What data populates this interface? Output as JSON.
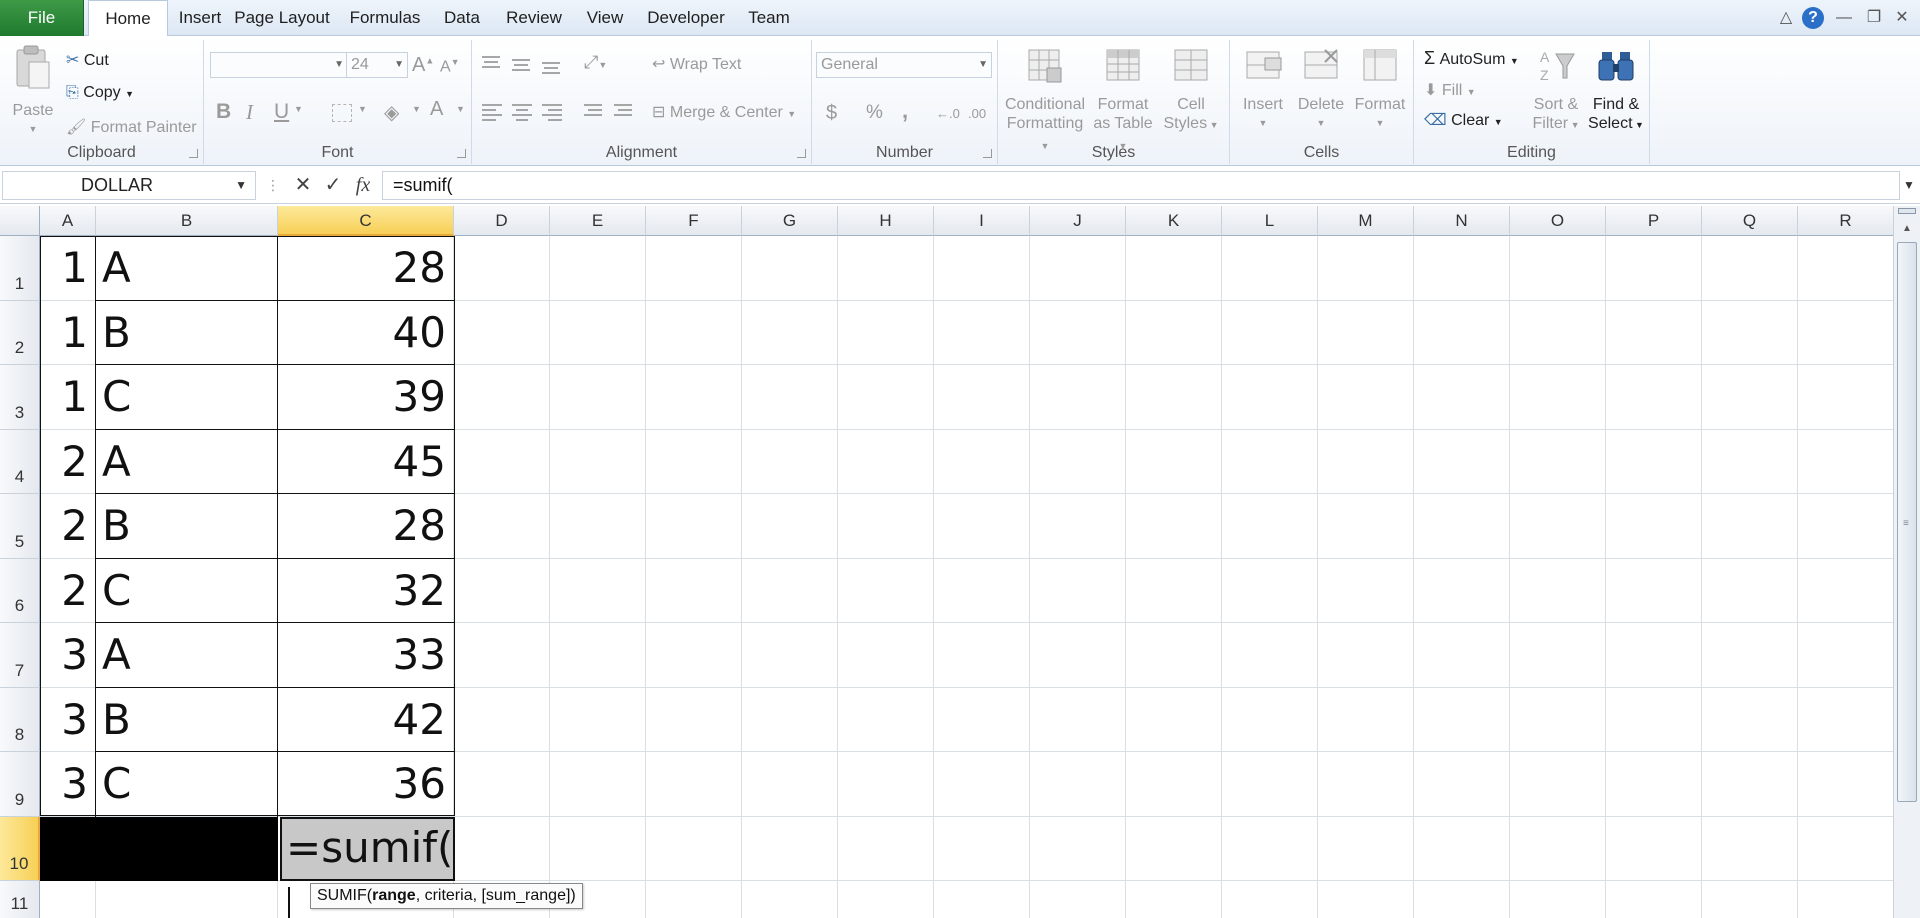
{
  "tabs": {
    "file": "File",
    "items": [
      "Home",
      "Insert",
      "Page Layout",
      "Formulas",
      "Data",
      "Review",
      "View",
      "Developer",
      "Team"
    ],
    "active": "Home"
  },
  "window_controls": {
    "collapse_ribbon": "△",
    "help": "?",
    "minimize": "—",
    "restore": "❐",
    "close": "✕"
  },
  "clipboard": {
    "paste": "Paste",
    "cut": "Cut",
    "copy": "Copy",
    "format_painter": "Format Painter",
    "label": "Clipboard"
  },
  "font": {
    "family_value": "",
    "size_value": "24",
    "grow": "A",
    "shrink": "A",
    "bold": "B",
    "italic": "I",
    "underline": "U",
    "font_color": "A",
    "label": "Font"
  },
  "alignment": {
    "wrap_text": "Wrap Text",
    "merge_center": "Merge & Center",
    "label": "Alignment"
  },
  "number": {
    "format_value": "General",
    "currency": "$",
    "percent": "%",
    "comma": ",",
    "inc_decimal": "←.0",
    "dec_decimal": ".00",
    "label": "Number"
  },
  "styles": {
    "conditional_1": "Conditional",
    "conditional_2": "Formatting",
    "format_table_1": "Format",
    "format_table_2": "as Table",
    "cell_styles_1": "Cell",
    "cell_styles_2": "Styles",
    "label": "Styles"
  },
  "cells": {
    "insert": "Insert",
    "delete": "Delete",
    "format": "Format",
    "label": "Cells"
  },
  "editing": {
    "autosum": "AutoSum",
    "fill": "Fill",
    "clear": "Clear",
    "sort_1": "Sort &",
    "sort_2": "Filter",
    "find_1": "Find &",
    "find_2": "Select",
    "label": "Editing"
  },
  "formula_bar": {
    "name_box": "DOLLAR",
    "cancel": "✕",
    "enter": "✓",
    "fx": "fx",
    "formula": "=sumif("
  },
  "grid": {
    "columns": [
      "A",
      "B",
      "C",
      "D",
      "E",
      "F",
      "G",
      "H",
      "I",
      "J",
      "K",
      "L",
      "M",
      "N",
      "O",
      "P",
      "Q",
      "R"
    ],
    "selected_column": "C",
    "rows": [
      "1",
      "2",
      "3",
      "4",
      "5",
      "6",
      "7",
      "8",
      "9",
      "10",
      "11"
    ],
    "selected_row": "10",
    "data": [
      {
        "a": "1",
        "b": "A",
        "c": "28"
      },
      {
        "a": "1",
        "b": "B",
        "c": "40"
      },
      {
        "a": "1",
        "b": "C",
        "c": "39"
      },
      {
        "a": "2",
        "b": "A",
        "c": "45"
      },
      {
        "a": "2",
        "b": "B",
        "c": "28"
      },
      {
        "a": "2",
        "b": "C",
        "c": "32"
      },
      {
        "a": "3",
        "b": "A",
        "c": "33"
      },
      {
        "a": "3",
        "b": "B",
        "c": "42"
      },
      {
        "a": "3",
        "b": "C",
        "c": "36"
      }
    ],
    "editing_cell_value": "=sumif(",
    "tooltip_fn": "SUMIF(",
    "tooltip_arg1": "range",
    "tooltip_rest": ", criteria, [sum_range])"
  },
  "colors": {
    "file_tab": "#1f7a2e",
    "selected_header": "#f7cf55",
    "ribbon_bg": "#eef3f9"
  }
}
